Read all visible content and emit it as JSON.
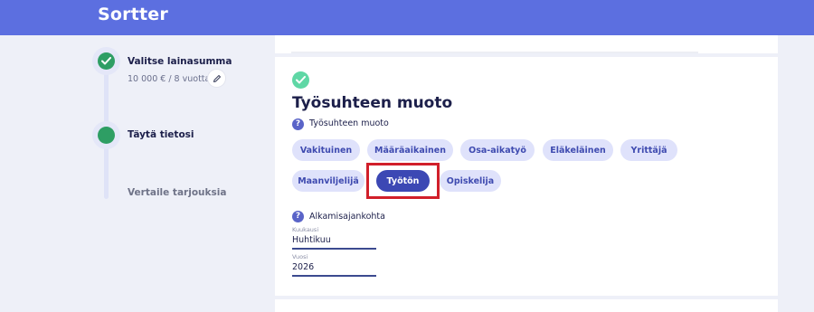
{
  "header": {
    "logo": "Sortter",
    "color": "#5c6fe0"
  },
  "stepper": {
    "steps": [
      {
        "title": "Valitse lainasumma",
        "subtitle": "10 000 € / 8 vuotta",
        "status": "done",
        "icon": "check-icon"
      },
      {
        "title": "Täytä tietosi",
        "status": "current"
      },
      {
        "title": "Vertaile tarjouksia",
        "status": "upcoming"
      }
    ],
    "edit_icon": "pencil-icon"
  },
  "section": {
    "status_icon": "check-icon",
    "title": "Työsuhteen muoto",
    "employment": {
      "label": "Työsuhteen muoto",
      "help_icon": "?",
      "options": [
        "Vakituinen",
        "Määräaikainen",
        "Osa-aikatyö",
        "Eläkeläinen",
        "Yrittäjä",
        "Maanviljelijä",
        "Työtön",
        "Opiskelija"
      ],
      "selected": "Työtön"
    },
    "start": {
      "label": "Alkamisajankohta",
      "help_icon": "?",
      "month": {
        "label": "Kuukausi",
        "value": "Huhtikuu"
      },
      "year": {
        "label": "Vuosi",
        "value": "2026"
      }
    }
  },
  "colors": {
    "accent": "#3c48b4",
    "chip": "#dfe2fb",
    "success": "#2e9e64",
    "highlight": "#d11f2a"
  }
}
